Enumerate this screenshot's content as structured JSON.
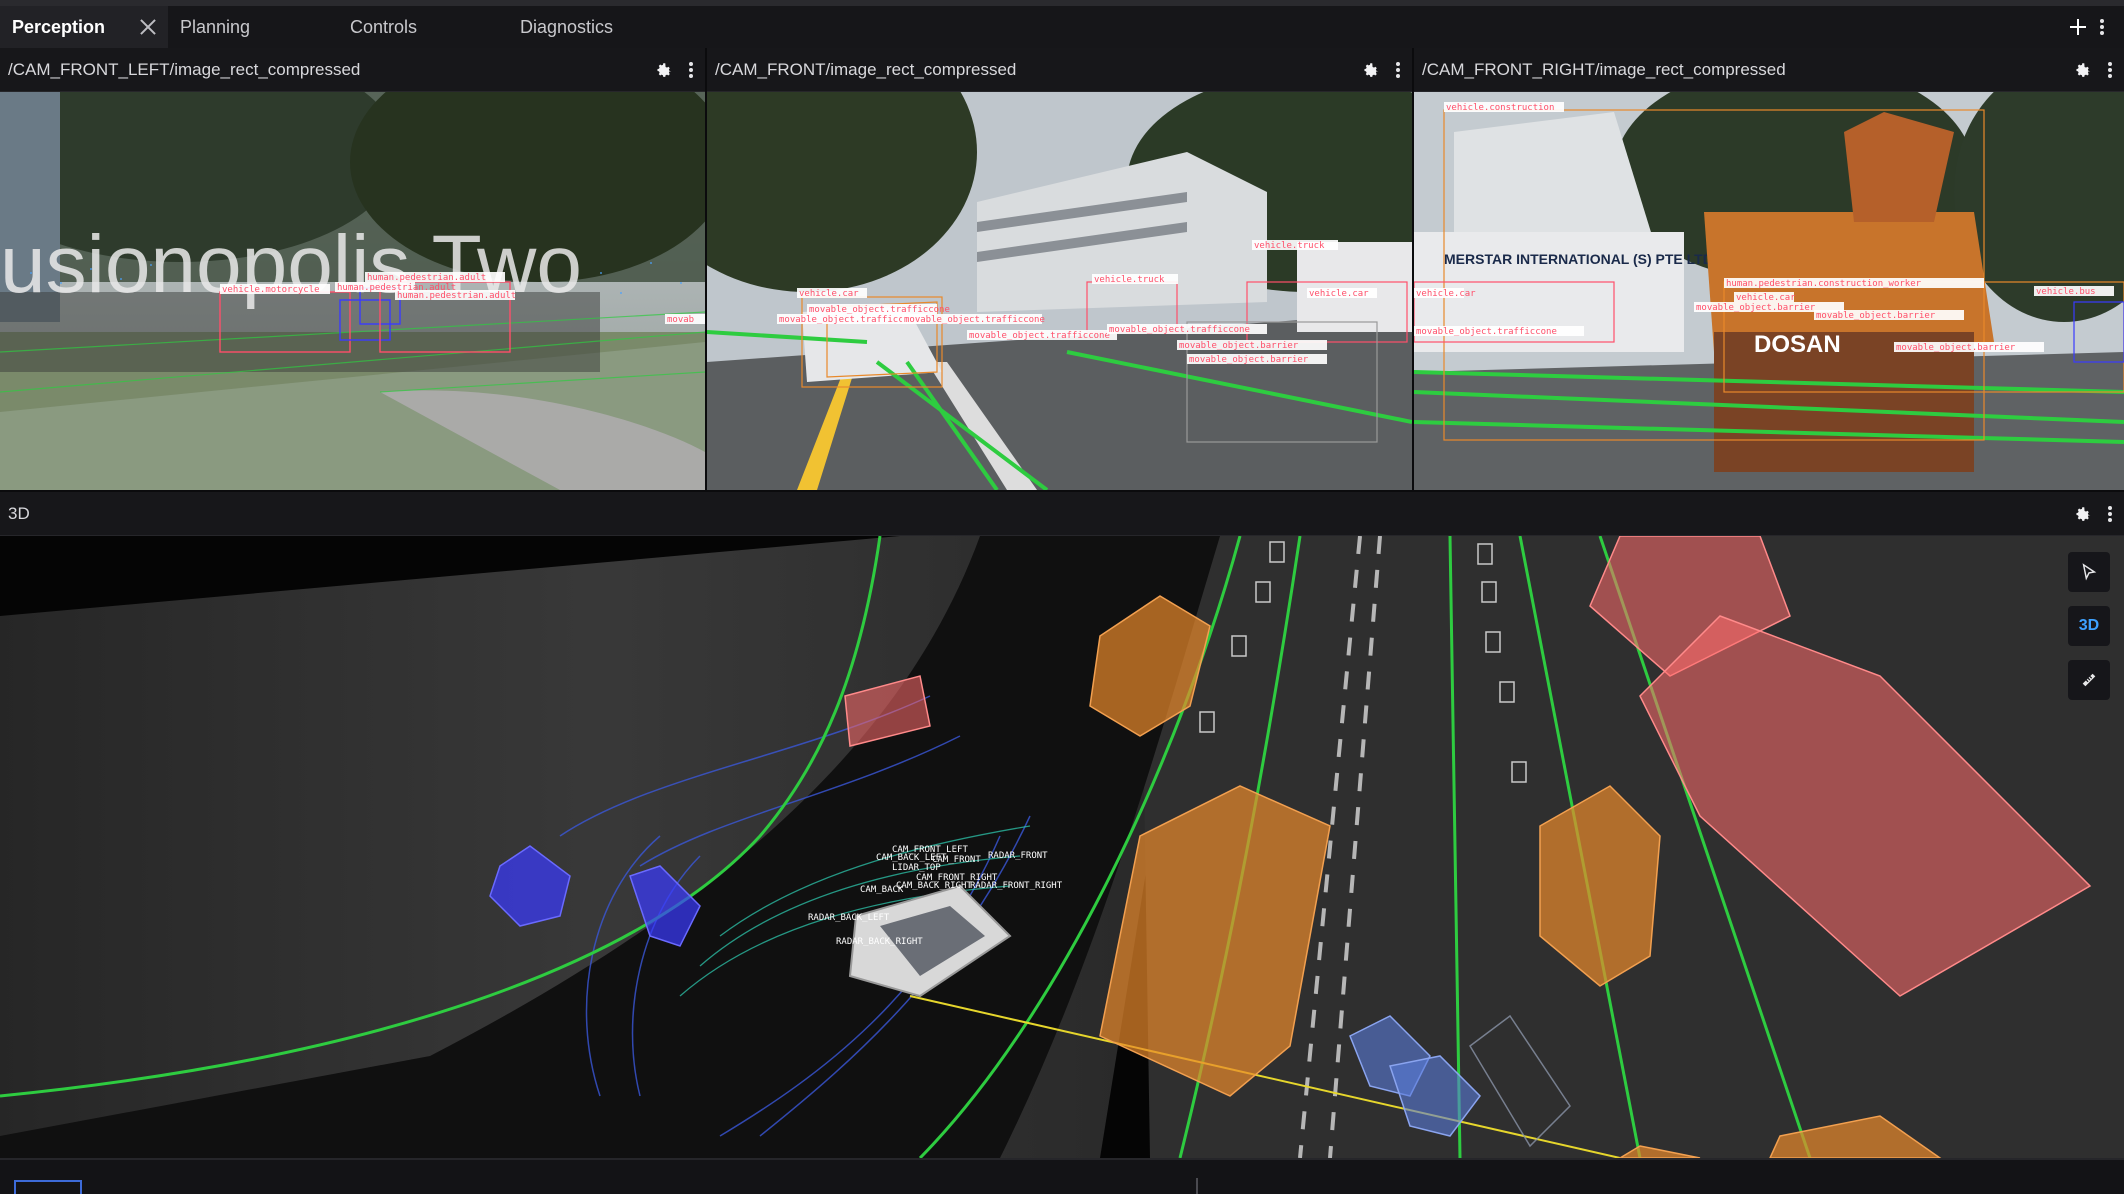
{
  "tabs": [
    {
      "label": "Perception",
      "active": true
    },
    {
      "label": "Planning",
      "active": false
    },
    {
      "label": "Controls",
      "active": false
    },
    {
      "label": "Diagnostics",
      "active": false
    }
  ],
  "panels": {
    "cam_front_left": {
      "title": "/CAM_FRONT_LEFT/image_rect_compressed"
    },
    "cam_front": {
      "title": "/CAM_FRONT/image_rect_compressed"
    },
    "cam_front_right": {
      "title": "/CAM_FRONT_RIGHT/image_rect_compressed"
    },
    "three_d": {
      "title": "3D"
    }
  },
  "sign_text": "usionopolis Two",
  "truck_text": "MERSTAR INTERNATIONAL (S) PTE LTD",
  "excavator_text": "DOSAN",
  "detections": {
    "left": [
      "vehicle.motorcycle",
      "human.pedestrian.adult",
      "human.pedestrian.adult",
      "human.pedestrian.adult",
      "movab"
    ],
    "front": [
      "vehicle.truck",
      "vehicle.car",
      "vehicle.truck",
      "movable_object.trafficcone",
      "movable_object.trafficcone",
      "movable_object.trafficcone",
      "movable_object.trafficcone",
      "movable_object.trafficcone",
      "movable_object.barrier",
      "movable_object.barrier",
      "vehicle.car"
    ],
    "right": [
      "vehicle.construction",
      "human.pedestrian.construction_worker",
      "vehicle.car",
      "movable_object.trafficcone",
      "movable_object.barrier",
      "movable_object.barrier",
      "movable_object.barrier",
      "vehicle.bus",
      "vehicle.car"
    ]
  },
  "sensor_labels": [
    "CAM_FRONT_LEFT",
    "CAM_BACK_LEFT",
    "CAM_FRONT",
    "RADAR_FRONT",
    "LIDAR_TOP",
    "CAM_FRONT_RIGHT",
    "CAM_BACK_RIGHT",
    "RADAR_FRONT_RIGHT",
    "CAM_BACK",
    "RADAR_BACK_LEFT",
    "RADAR_BACK_RIGHT"
  ],
  "toolbar_3d": {
    "view_mode": "3D"
  },
  "colors": {
    "accent": "#3ea2ff",
    "lane_green": "#2ecc40",
    "box_orange": "#e8892b",
    "box_red": "#ff6b6b",
    "box_blue": "#3a3aff",
    "label_red": "#ff4f6a"
  }
}
